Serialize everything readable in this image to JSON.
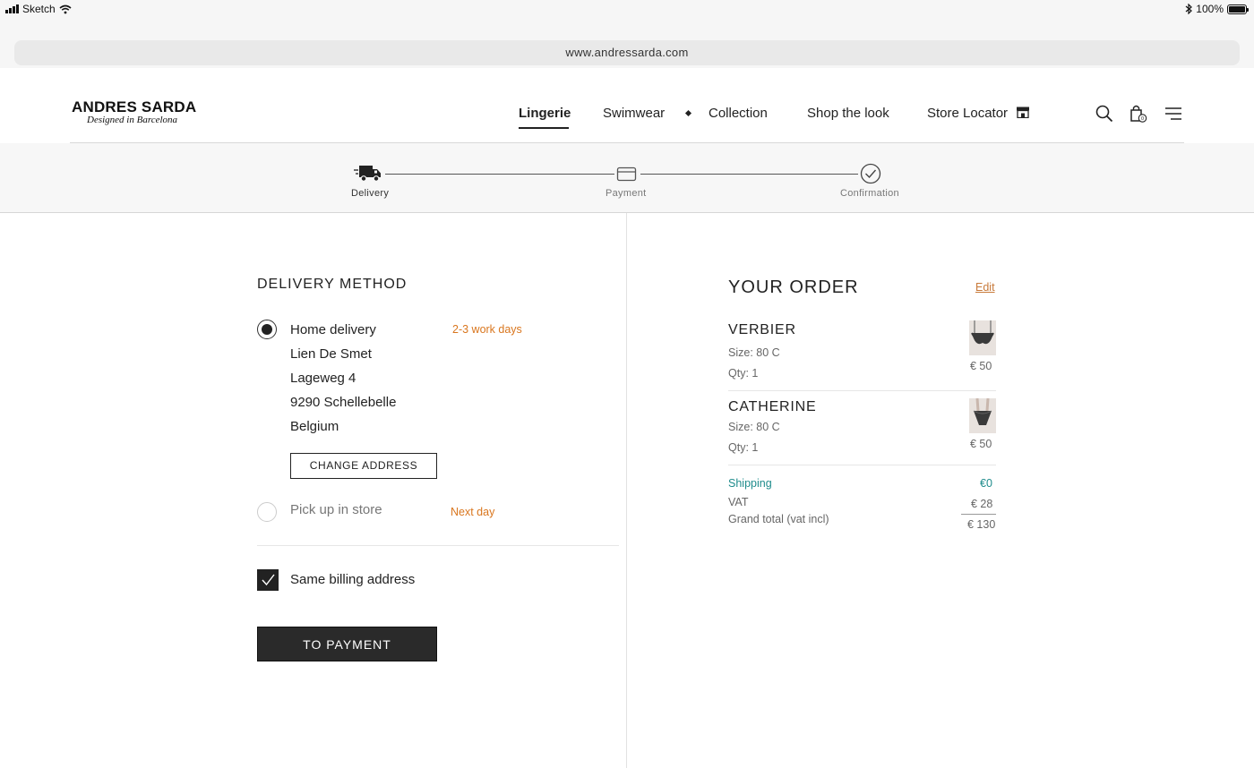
{
  "status_bar": {
    "carrier": "Sketch",
    "battery": "100%"
  },
  "browser": {
    "url": "www.andressarda.com"
  },
  "header": {
    "brand": "ANDRES SARDA",
    "tagline": "Designed in Barcelona",
    "nav": [
      "Lingerie",
      "Swimwear",
      "Collection",
      "Shop the look",
      "Store Locator"
    ],
    "active_nav": "Lingerie"
  },
  "progress": {
    "steps": [
      "Delivery",
      "Payment",
      "Confirmation"
    ],
    "active_step": "Delivery"
  },
  "delivery": {
    "title": "DELIVERY METHOD",
    "home_option": {
      "label": "Home delivery",
      "eta": "2-3 work days",
      "selected": true,
      "address": [
        "Lien De Smet",
        "Lageweg 4",
        "9290 Schellebelle",
        "Belgium"
      ]
    },
    "change_address_label": "CHANGE ADDRESS",
    "store_option": {
      "label": "Pick up in store",
      "eta": "Next day",
      "selected": false
    },
    "billing_label": "Same billing address",
    "billing_checked": true,
    "submit_label": "TO PAYMENT"
  },
  "order": {
    "title": "YOUR ORDER",
    "edit_label": "Edit",
    "items": [
      {
        "name": "VERBIER",
        "size": "Size: 80 C",
        "qty": "Qty: 1",
        "price": "€ 50"
      },
      {
        "name": "CATHERINE",
        "size": "Size: 80 C",
        "qty": "Qty: 1",
        "price": "€ 50"
      }
    ],
    "shipping_label": "Shipping",
    "shipping_value": "€0",
    "vat_label": "VAT",
    "vat_value": "€ 28",
    "total_label": "Grand total (vat incl)",
    "total_value": "€ 130"
  },
  "colors": {
    "accent_orange": "#d9761e",
    "teal": "#1f8c8c",
    "dark": "#2a2a2a"
  }
}
